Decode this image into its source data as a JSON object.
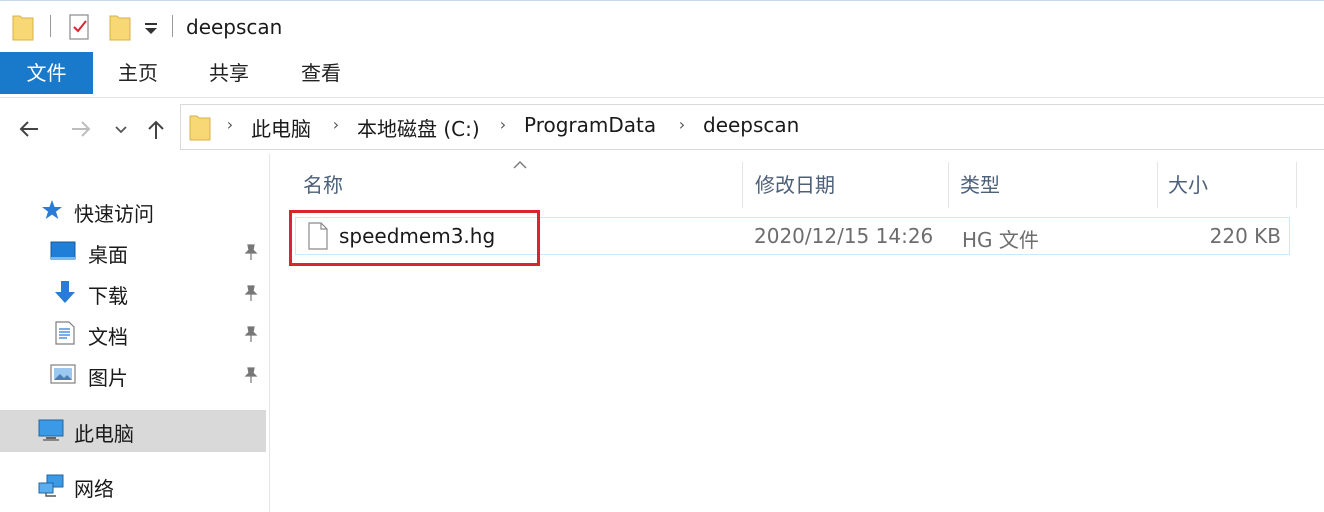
{
  "window": {
    "title": "deepscan"
  },
  "ribbon": {
    "tabs": [
      "文件",
      "主页",
      "共享",
      "查看"
    ]
  },
  "address": {
    "crumbs": [
      "此电脑",
      "本地磁盘 (C:)",
      "ProgramData",
      "deepscan"
    ]
  },
  "navigation": {
    "quick_access": "快速访问",
    "pinned": [
      {
        "label": "桌面",
        "icon": "desktop-icon"
      },
      {
        "label": "下载",
        "icon": "download-arrow-icon"
      },
      {
        "label": "文档",
        "icon": "document-icon"
      },
      {
        "label": "图片",
        "icon": "pictures-icon"
      }
    ],
    "this_pc": "此电脑",
    "network": "网络"
  },
  "columns": {
    "name": "名称",
    "modified": "修改日期",
    "type": "类型",
    "size": "大小"
  },
  "files": [
    {
      "name": "speedmem3.hg",
      "modified": "2020/12/15 14:26",
      "type": "HG 文件",
      "size": "220 KB"
    }
  ],
  "colors": {
    "accent": "#1979ca",
    "highlight_box": "#d6262e",
    "selection_border": "#cce8ff",
    "nav_selected": "#d9d9d9"
  }
}
